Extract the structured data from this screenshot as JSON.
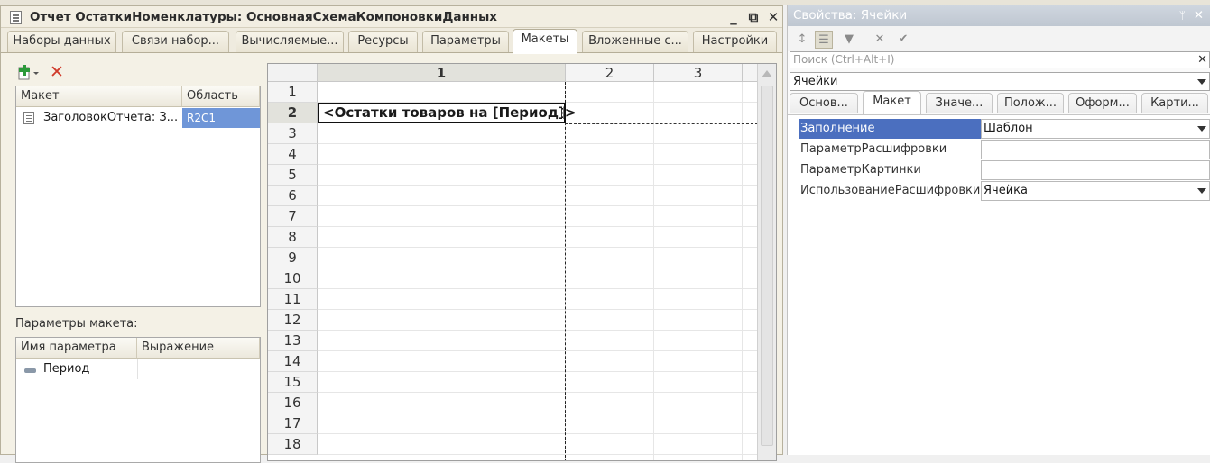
{
  "editor": {
    "title": "Отчет ОстаткиНоменклатуры: ОсновнаяСхемаКомпоновкиДанных",
    "window_buttons": {
      "minimize": "_",
      "restore": "⧉",
      "close": "✕"
    },
    "tabs": [
      {
        "label": "Наборы данных"
      },
      {
        "label": "Связи набор..."
      },
      {
        "label": "Вычисляемые..."
      },
      {
        "label": "Ресурсы"
      },
      {
        "label": "Параметры"
      },
      {
        "label": "Макеты",
        "active": true
      },
      {
        "label": "Вложенные с..."
      },
      {
        "label": "Настройки"
      }
    ],
    "layouts": {
      "columns": [
        "Макет",
        "Область"
      ],
      "rows": [
        {
          "name": "ЗаголовокОтчета: З...",
          "area": "R2C1"
        }
      ]
    },
    "params_label": "Параметры макета:",
    "params": {
      "columns": [
        "Имя параметра",
        "Выражение"
      ],
      "rows": [
        {
          "name": "Период",
          "expression": ""
        }
      ]
    },
    "sheet": {
      "columns": [
        "1",
        "2",
        "3"
      ],
      "rows": [
        "1",
        "2",
        "3",
        "4",
        "5",
        "6",
        "7",
        "8",
        "9",
        "10",
        "11",
        "12",
        "13",
        "14",
        "15",
        "16",
        "17",
        "18"
      ],
      "selected_row": "2",
      "selected_col": "1",
      "cell_text": "<Остатки товаров на [Период]>"
    }
  },
  "props": {
    "title": "Свойства: Ячейки",
    "pin": "ᛘ",
    "close": "✕",
    "search_placeholder": "Поиск (Ctrl+Alt+I)",
    "search_clear": "✕",
    "object": "Ячейки",
    "tabs": [
      {
        "label": "Основ..."
      },
      {
        "label": "Макет",
        "active": true
      },
      {
        "label": "Значе..."
      },
      {
        "label": "Полож..."
      },
      {
        "label": "Оформ..."
      },
      {
        "label": "Карти..."
      }
    ],
    "properties": [
      {
        "name": "Заполнение",
        "value": "Шаблон",
        "dropdown": true,
        "selected": true
      },
      {
        "name": "ПараметрРасшифровки",
        "value": ""
      },
      {
        "name": "ПараметрКартинки",
        "value": ""
      },
      {
        "name": "ИспользованиеРасшифровки",
        "value": "Ячейка",
        "dropdown": true
      }
    ]
  },
  "colors": {
    "selection": "#4b6fbf",
    "area_highlight": "#6f96d8",
    "delete": "#d03a2a"
  }
}
